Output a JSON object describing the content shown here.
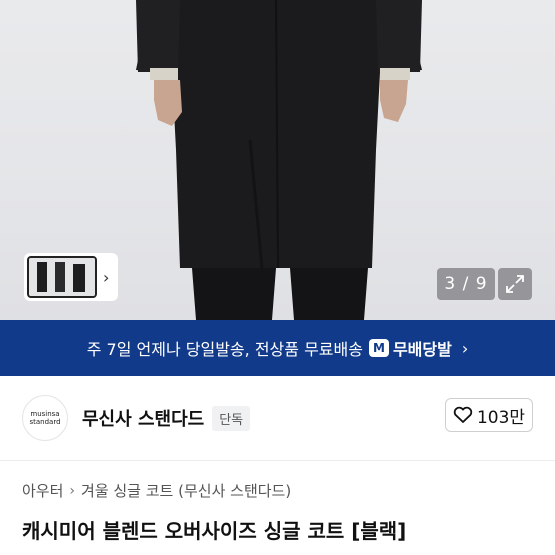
{
  "gallery": {
    "counter": "3 / 9",
    "expand_icon": "expand-icon",
    "thumbnail_next_icon": "chevron-right-icon"
  },
  "banner": {
    "text": "주 7일 언제나 당일발송, 전상품 무료배송",
    "badge_icon_text": "M",
    "badge_label": "무배당발",
    "chevron": "›",
    "background": "#123a8a"
  },
  "brand": {
    "logo_line1": "musinsa",
    "logo_line2": "standard",
    "name": "무신사 스탠다드",
    "tag": "단독",
    "like_count": "103만"
  },
  "breadcrumb": {
    "items": [
      "아우터",
      "겨울 싱글 코트 (무신사 스탠다드)"
    ],
    "separator": "›"
  },
  "product": {
    "title": "캐시미어 블렌드 오버사이즈 싱글 코트 [블랙]"
  }
}
